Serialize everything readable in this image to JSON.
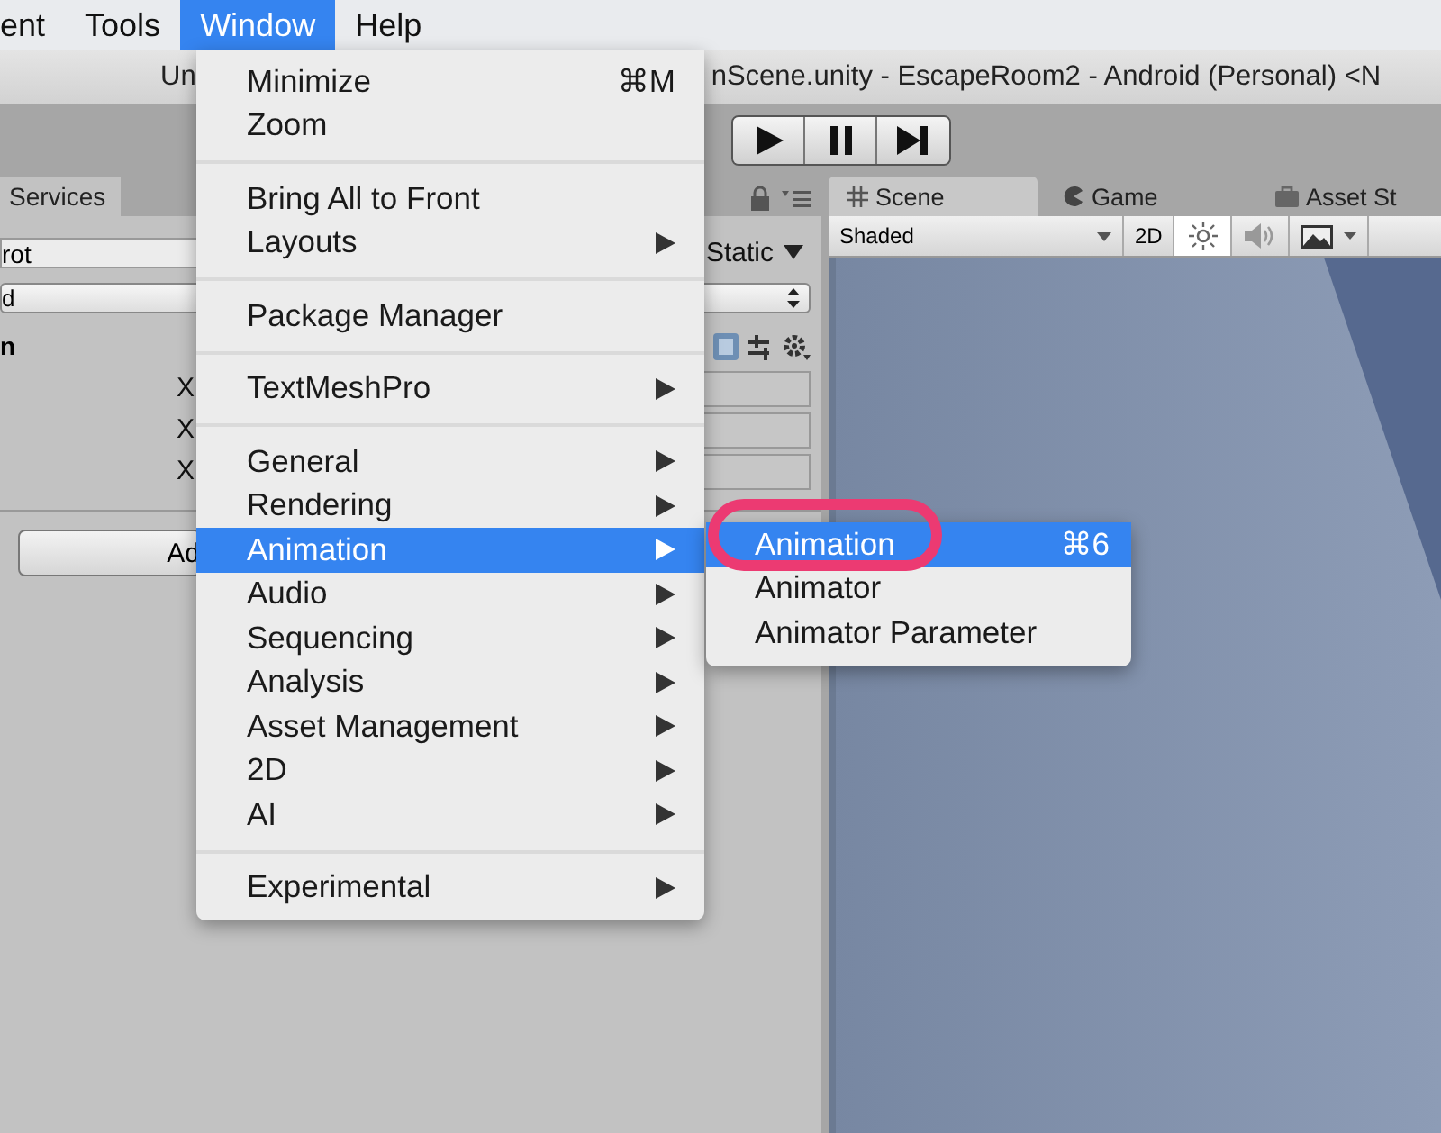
{
  "menu_bar": [
    {
      "label": "ent",
      "selected": false
    },
    {
      "label": "Tools",
      "selected": false
    },
    {
      "label": "Window",
      "selected": true
    },
    {
      "label": "Help",
      "selected": false
    }
  ],
  "window_title": {
    "left_part": "Un",
    "right_part": "nScene.unity - EscapeRoom2 - Android (Personal) <N"
  },
  "inspector": {
    "tab": "Services",
    "name_field": "rot",
    "static_label": "Static",
    "dropdown": "d",
    "component_header": "n",
    "axis_labels": [
      "X",
      "X",
      "X"
    ],
    "add_button": "Ad"
  },
  "scene_tabs": [
    {
      "label": "Scene",
      "selected": true,
      "kind": "grid"
    },
    {
      "label": "Game",
      "selected": false,
      "kind": "game"
    },
    {
      "label": "Asset St",
      "selected": false,
      "kind": "store"
    }
  ],
  "scene_toolbar": {
    "shading": "Shaded",
    "mode_2d": "2D",
    "lighting_on": true,
    "audio_on": false
  },
  "window_menu": [
    [
      {
        "label": "Minimize",
        "shortcut": "⌘M",
        "has_submenu": false,
        "selected": false
      },
      {
        "label": "Zoom",
        "has_submenu": false,
        "selected": false
      }
    ],
    [
      {
        "label": "Bring All to Front",
        "has_submenu": false,
        "selected": false
      },
      {
        "label": "Layouts",
        "has_submenu": true,
        "selected": false
      }
    ],
    [
      {
        "label": "Package Manager",
        "has_submenu": false,
        "selected": false
      }
    ],
    [
      {
        "label": "TextMeshPro",
        "has_submenu": true,
        "selected": false
      }
    ],
    [
      {
        "label": "General",
        "has_submenu": true,
        "selected": false
      },
      {
        "label": "Rendering",
        "has_submenu": true,
        "selected": false
      },
      {
        "label": "Animation",
        "has_submenu": true,
        "selected": true
      },
      {
        "label": "Audio",
        "has_submenu": true,
        "selected": false
      },
      {
        "label": "Sequencing",
        "has_submenu": true,
        "selected": false
      },
      {
        "label": "Analysis",
        "has_submenu": true,
        "selected": false
      },
      {
        "label": "Asset Management",
        "has_submenu": true,
        "selected": false
      },
      {
        "label": "2D",
        "has_submenu": true,
        "selected": false
      },
      {
        "label": "AI",
        "has_submenu": true,
        "selected": false
      }
    ],
    [
      {
        "label": "Experimental",
        "has_submenu": true,
        "selected": false
      }
    ]
  ],
  "animation_submenu": [
    {
      "label": "Animation",
      "shortcut": "⌘6",
      "selected": true,
      "circled": true
    },
    {
      "label": "Animator",
      "selected": false,
      "circled": false
    },
    {
      "label": "Animator Parameter",
      "selected": false,
      "circled": false
    }
  ]
}
